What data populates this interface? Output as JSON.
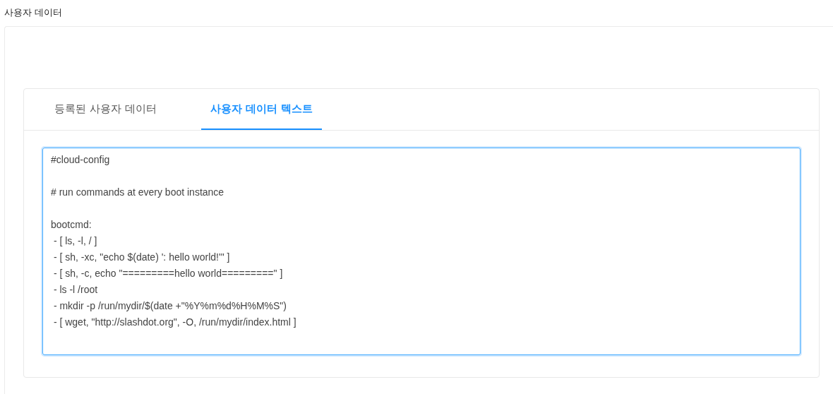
{
  "section_title": "사용자 데이터",
  "tabs": [
    {
      "label": "등록된 사용자 데이터",
      "selected": false
    },
    {
      "label": "사용자 데이터 텍스트",
      "selected": true
    }
  ],
  "editor": {
    "value": "#cloud-config\n\n# run commands at every boot instance\n\nbootcmd:\n - [ ls, -l, / ]\n - [ sh, -xc, \"echo $(date) ': hello world!'\" ]\n - [ sh, -c, echo \"=========hello world=========\" ]\n - ls -l /root\n - mkdir -p /run/mydir/$(date +\"%Y%m%d%H%M%S\")\n - [ wget, \"http://slashdot.org\", -O, /run/mydir/index.html ]",
    "focused": true
  }
}
